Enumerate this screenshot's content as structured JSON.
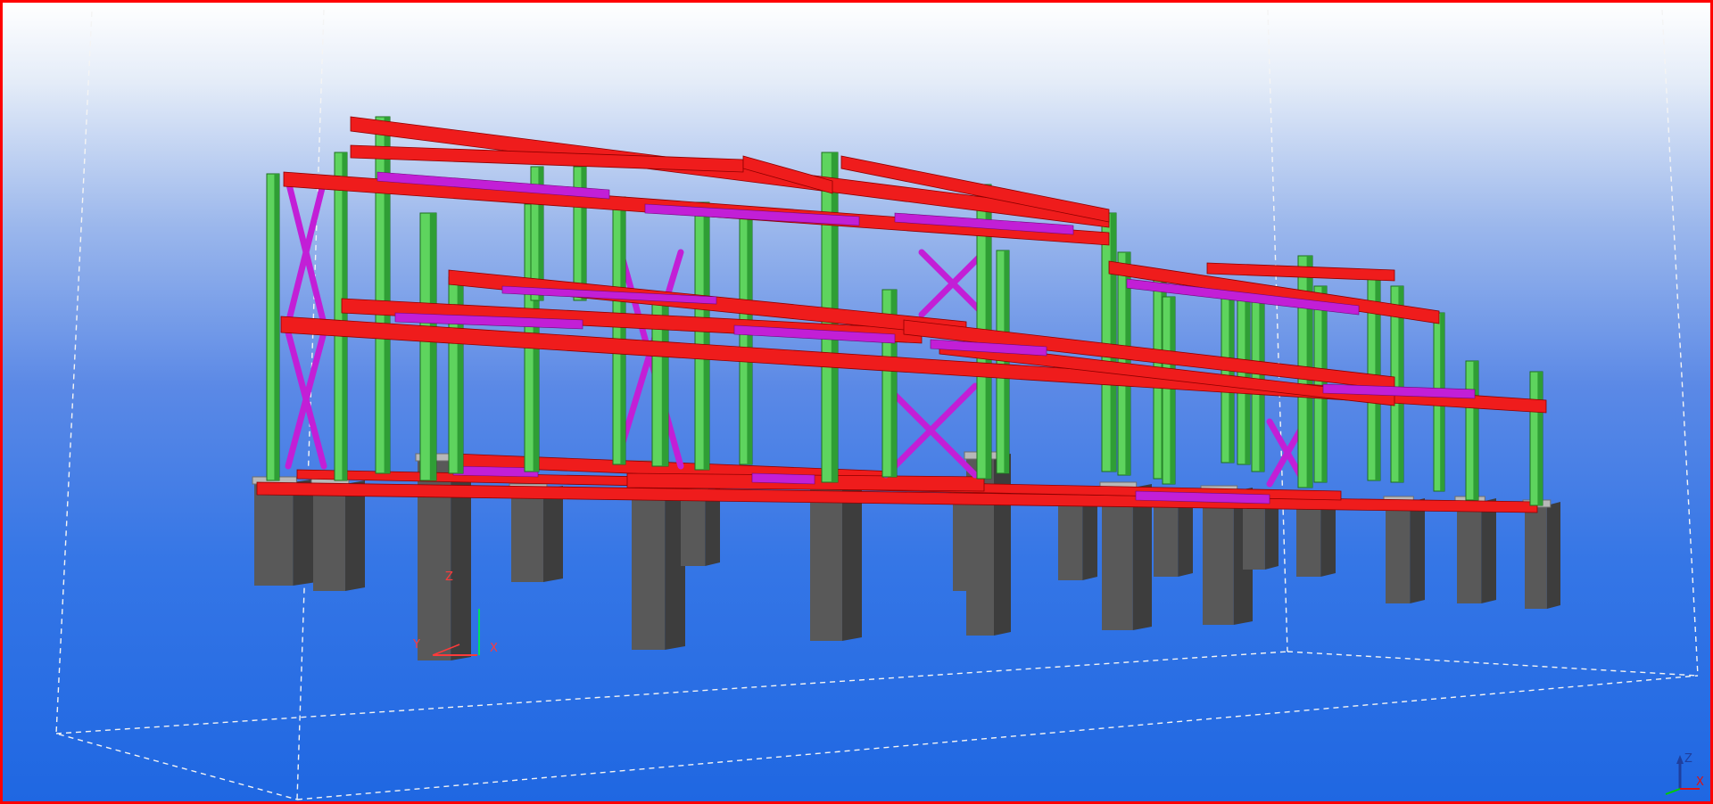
{
  "viewport": {
    "border_color": "#ff0000",
    "background_top": "#ffffff",
    "background_bottom": "#1f67e2"
  },
  "model_colors": {
    "column": "#5ed45e",
    "beam": "#ef1c1c",
    "purlin_and_bracing": "#c21fd6",
    "pier": "#595959"
  },
  "local_axes": {
    "x": "X",
    "y": "Y",
    "z": "Z"
  },
  "view_triad": {
    "x": "X",
    "z": "Z"
  },
  "icons": {
    "local_axes": "coordinate-axes-icon",
    "view_triad": "view-orientation-triad-icon"
  }
}
